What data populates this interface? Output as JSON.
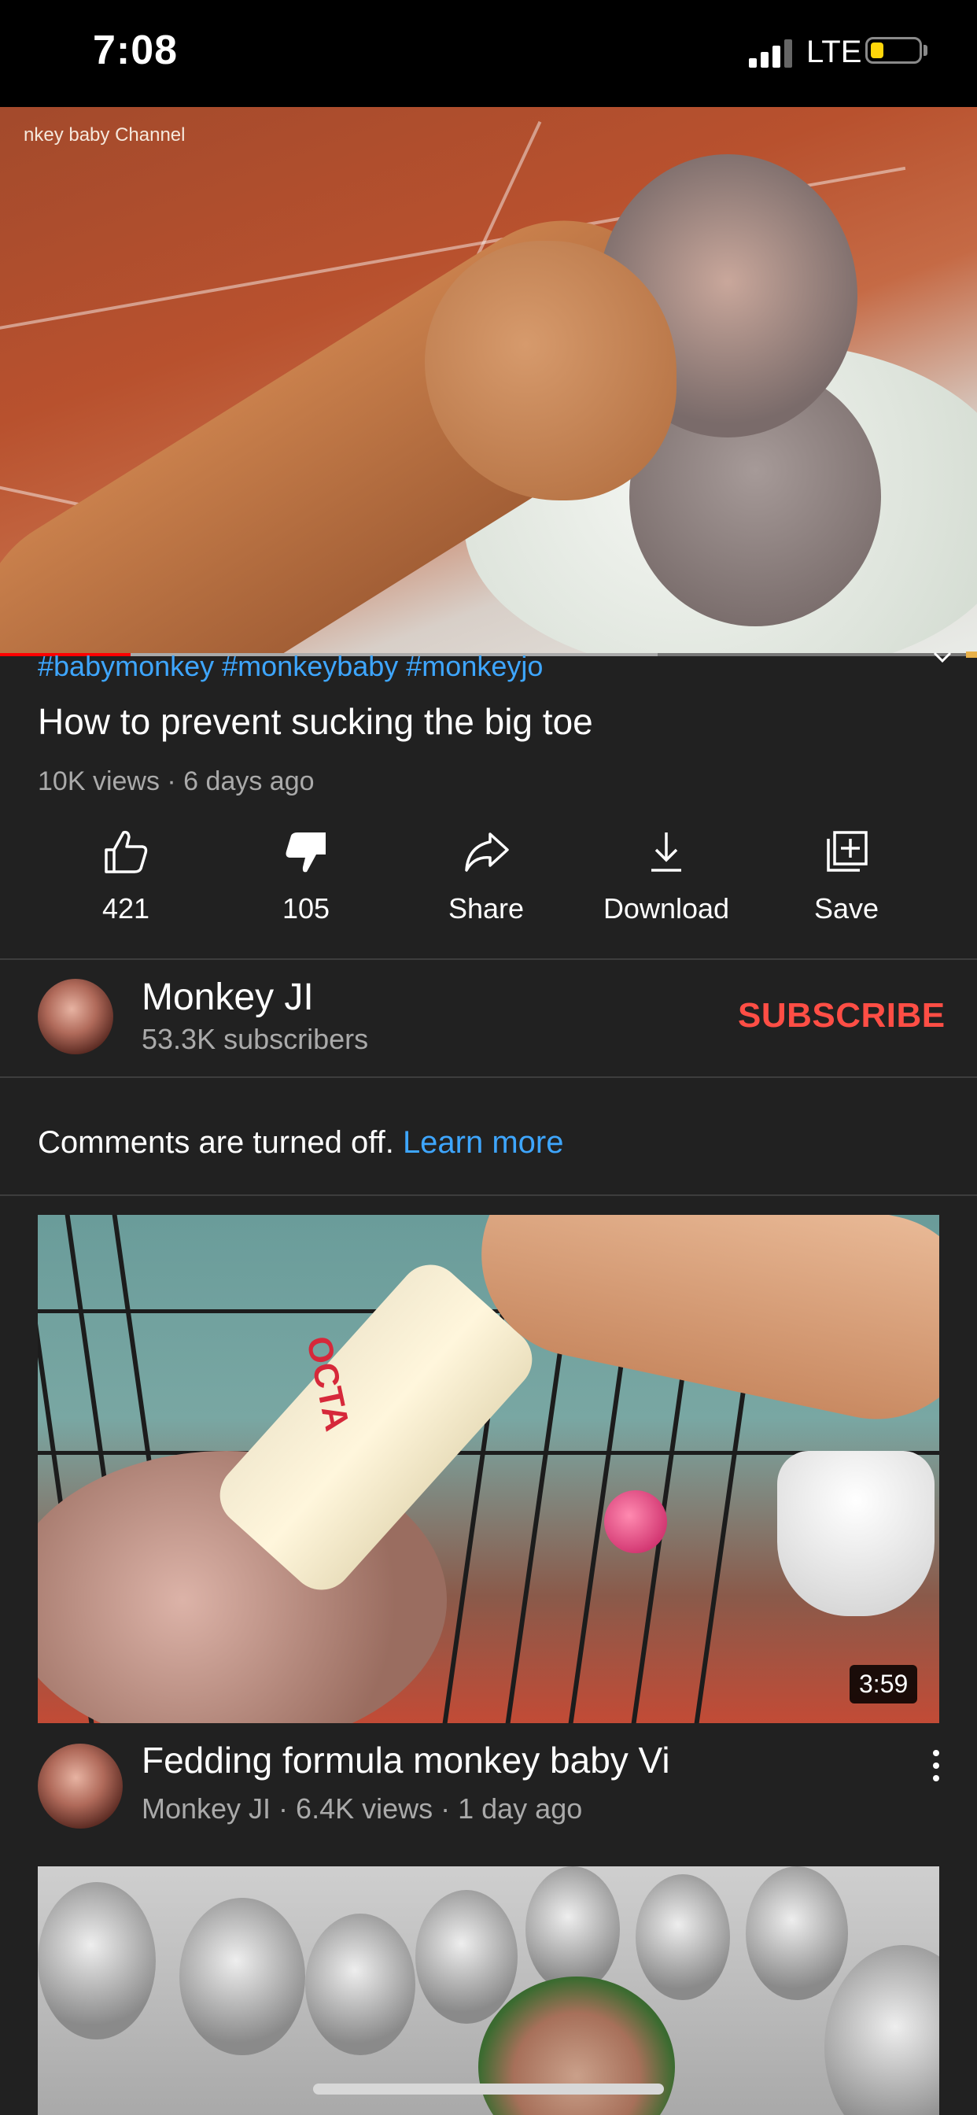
{
  "status_bar": {
    "time": "7:08",
    "network": "LTE"
  },
  "player": {
    "watermark": "nkey baby Channel"
  },
  "video": {
    "hashtags": "#babymonkey #monkeybaby #monkeyjo",
    "title": "How to prevent sucking the big toe",
    "meta": "10K views · 6 days ago"
  },
  "actions": [
    {
      "icon": "thumbs-up-icon",
      "label": "421"
    },
    {
      "icon": "thumbs-down-icon",
      "label": "105"
    },
    {
      "icon": "share-icon",
      "label": "Share"
    },
    {
      "icon": "download-icon",
      "label": "Download"
    },
    {
      "icon": "save-icon",
      "label": "Save"
    }
  ],
  "channel": {
    "name": "Monkey JI",
    "subscribers": "53.3K subscribers",
    "subscribe_label": "SUBSCRIBE"
  },
  "comments": {
    "text": "Comments are turned off.",
    "link": "Learn more"
  },
  "recommended": [
    {
      "title": "Fedding formula monkey baby Vi",
      "meta": "Monkey JI · 6.4K views · 1 day ago",
      "duration": "3:59",
      "thumb_text": "OCTA"
    }
  ],
  "colors": {
    "background": "#212121",
    "accent_link": "#3ea6ff",
    "subscribe": "#ff4e45",
    "progress_played": "#ff0000"
  }
}
